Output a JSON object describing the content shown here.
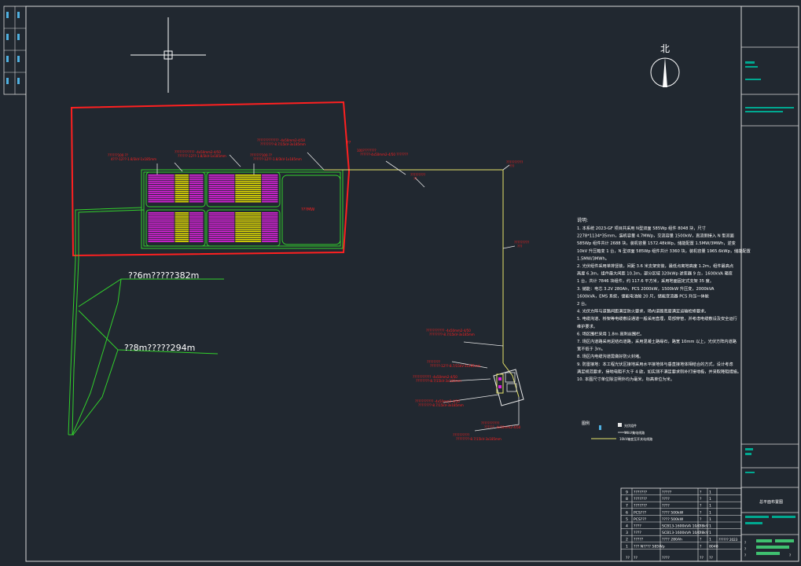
{
  "drawing": {
    "north_label": "北",
    "pv_area_tag": "???MW",
    "slope_note_1": "??6m?????382m",
    "slope_note_2": "??8m?????294m",
    "corner_mark": "??"
  },
  "cable_labels": [
    {
      "line1": "??????100 ??",
      "line2": "4???-12??-1.8/3kV-1x185mm"
    },
    {
      "line1": "???????????? -4x50mm2-4/50",
      "line2": "??????-12??-1.8/3kV-1x185mm"
    },
    {
      "line1": "???????100 ??",
      "line2": "??????-12??-1.8/3kV-1x185mm"
    },
    {
      "line1": "????????????? -4x50mm2-4/50",
      "line2": "????????-8.7/15kV-3x185mm"
    },
    {
      "line1": "100????????",
      "line2": "??????-4x50mm2-4/50 ???????"
    },
    {
      "line1": "?????????",
      "line2": "??"
    },
    {
      "line1": "??????????",
      "line2": "???"
    },
    {
      "line1": "?????????",
      "line2": "???"
    },
    {
      "line1": "??????????? -4x50mm2-4/50",
      "line2": "????????-8.7/15kV-3x185mm"
    },
    {
      "line1": "????????",
      "line2": "??????-12??-8.7/15kV-3x185mm"
    },
    {
      "line1": "??????????? -4x50mm2-4/50",
      "line2": "????????-8.7/15kV-3x185mm"
    },
    {
      "line1": "??????????? -4x50mm2-4/50",
      "line2": "????????-8.7/15kV-3x185mm"
    },
    {
      "line1": "???????????",
      "line2": "?????? -4x50mm2-4/50"
    },
    {
      "line1": "??????????",
      "line2": "????????-8.7/15kV-3x185mm"
    }
  ],
  "notes": {
    "heading": "说明:",
    "lines": [
      "1. 本系统 2023-GF 项目共采用 N型双面 585Wp 组件 8048 块，尺寸",
      "2278*1134*35mm，装机容量 4.7MWp，交流容量 1500kW，直流侧接入 N 型双面",
      "585Wp 组件共计 2688 块，装机容量 1572.48kWp，储能配置 1.5MW/3MWh，逆变",
      "10kV 升压箱变 1 台，N 型双面 585Wp 组件共计 3360 块，装机容量 1965.6kWp，储能配置",
      "1.5MW/3MWh。",
      "2. 光伏组件采用单排竖装，间距 3.6 米支架安装，最低点离地高度 1.2m，组件最高点",
      "高度 6.3m，组件最大间距 10.3m，部分区域 320kWp 逆变器 9 台，1600kVA 箱变",
      "1 台，共计 7846 块组件，约 117.6 平方米，采用地面固定式支架 35 度。",
      "3. 储能：电芯 3.2V 280Ah，PCS 2000kW，1500kW 升压变，2000kVA",
      "1600kVA，EMS 系统，储能电池舱 20 尺，储能变流器 PCS 升压一体舱",
      "2 台。",
      "4. 光伏方阵与道路间距满足防火要求，场内道路宽度满足运输检修要求。",
      "5. 电缆沟道、桥架等电缆敷设通道一般采用直埋，局部穿管，并考虑电缆敷设及安全运行",
      "维护要求。",
      "6. 场区围栏采用 1.8m 高刺丝围栏。",
      "7. 场区内道路采用泥结石道路，采用混凝土路缘石，路宽 10mm 以上，光伏方阵内道路",
      "宽不低于 3m。",
      "8. 场区内电缆沟道需做好防火封堵。",
      "9. 防雷接地：本工程光伏区接地采用水平接地体与垂直接地体相结合的方式，设计考虑",
      "满足规范要求，接地电阻不大于 4 欧，如实测不满足要求则补打接地极，并采取降阻措施。",
      "10. 本图尺寸单位除注明外均为毫米，标高单位为米。"
    ]
  },
  "legend": {
    "heading": "图例",
    "items": [
      "光伏组件",
      "10kV集电线路",
      "10kV箱变至开关站线路"
    ]
  },
  "table": {
    "rows": [
      [
        "9",
        "???????",
        "?????",
        "?",
        "1"
      ],
      [
        "8",
        "???????",
        "????",
        "?",
        "1"
      ],
      [
        "7",
        "???????",
        "????",
        "?",
        "1"
      ],
      [
        "6",
        "PCS???",
        "???? 500kW",
        "?",
        "1"
      ],
      [
        "5",
        "PCS???",
        "???? 500kW",
        "?",
        "1"
      ],
      [
        "4",
        "????",
        "SCB13-1600kVA 10/0.8kV",
        "?",
        "1"
      ],
      [
        "3",
        "????",
        "SCB13-1600kVA 10/0.8kV",
        "?",
        "1"
      ],
      [
        "2",
        "?????",
        "???? 280Ah",
        "?",
        "1"
      ],
      [
        "1",
        "??? N???? 585Wp",
        "",
        "?",
        "8048"
      ]
    ],
    "footer": [
      "??",
      "??",
      "????",
      "??",
      "??"
    ],
    "side_code": "?????? 2023"
  },
  "title_block": {
    "drawing_title": "总平面布置图",
    "small_marks": [
      "?",
      "?",
      "?",
      "?"
    ]
  },
  "colors": {
    "background": "#212830",
    "red_boundary": "#ff2020",
    "magenta_pv": "#e020e0",
    "yellow_pv": "#e8e000",
    "green_line": "#32d02c",
    "white_line": "#e8e8e8",
    "cable_yellow": "#e6e36a",
    "teal_block": "#00a890"
  }
}
